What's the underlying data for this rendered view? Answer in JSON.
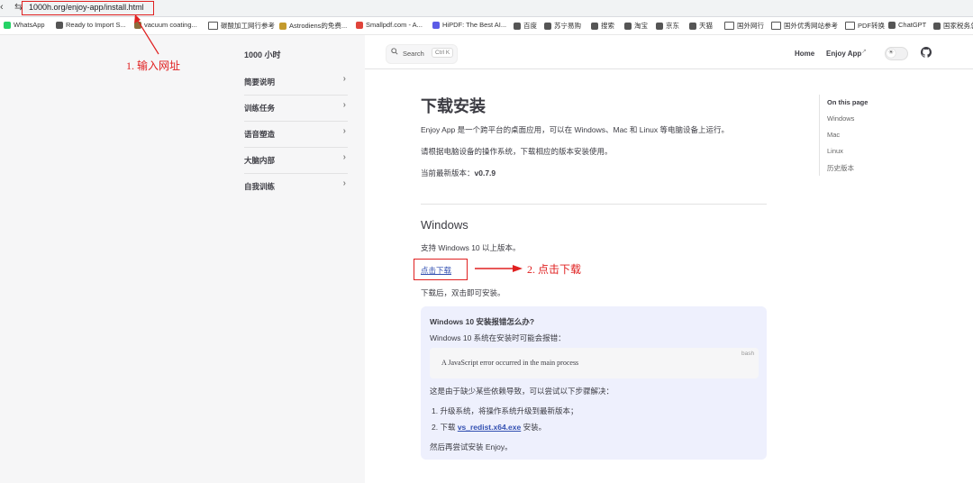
{
  "browser": {
    "url": "1000h.org/enjoy-app/install.html",
    "bookmarks": [
      {
        "label": "WhatsApp",
        "color": "#25d366"
      },
      {
        "label": "Ready to Import S...",
        "color": "#555555"
      },
      {
        "label": "vacuum coating...",
        "color": "#8a6d3b"
      },
      {
        "label": "碳酸加工网行参考",
        "color": "folder"
      },
      {
        "label": "Astrodiens的免费...",
        "color": "#c49a2c"
      },
      {
        "label": "Smallpdf.com - A...",
        "color": "#e0443a"
      },
      {
        "label": "HiPDF: The Best AI...",
        "color": "#5b5be6"
      },
      {
        "label": "百度",
        "color": "#555555"
      },
      {
        "label": "苏宁易购",
        "color": "#555555"
      },
      {
        "label": "搜索",
        "color": "#555555"
      },
      {
        "label": "淘宝",
        "color": "#555555"
      },
      {
        "label": "京东",
        "color": "#555555"
      },
      {
        "label": "天猫",
        "color": "#555555"
      },
      {
        "label": "国外网行",
        "color": "folder"
      },
      {
        "label": "国外优秀网站参考",
        "color": "folder"
      },
      {
        "label": "PDF转换",
        "color": "folder"
      },
      {
        "label": "ChatGPT",
        "color": "#555555"
      },
      {
        "label": "国家税务总",
        "color": "#555555"
      }
    ]
  },
  "sidebar": {
    "title": "1000 小时",
    "items": [
      "简要说明",
      "训练任务",
      "语音塑造",
      "大脑内部",
      "自我训练"
    ]
  },
  "topnav": {
    "search_label": "Search",
    "search_key": "Ctrl K",
    "home": "Home",
    "enjoy": "Enjoy App"
  },
  "content": {
    "title": "下载安装",
    "intro": "Enjoy App 是一个跨平台的桌面应用，可以在 Windows、Mac 和 Linux 等电脑设备上运行。",
    "choose": "请根据电脑设备的操作系统，下载相应的版本安装使用。",
    "version_label": "当前最新版本：",
    "version_value": "v0.7.9",
    "windows_heading": "Windows",
    "win_support": "支持 Windows 10 以上版本。",
    "download_link": "点击下载",
    "after_download": "下载后，双击即可安装。",
    "tip_title": "Windows 10 安装报错怎么办?",
    "tip_desc": "Windows 10 系统在安装时可能会报错：",
    "code_lang": "bash",
    "code_text": "A JavaScript error occurred in the main process",
    "reason": "这是由于缺少某些依赖导致，可以尝试以下步骤解决：",
    "step1": "1. 升级系统，将操作系统升级到最新版本；",
    "step2_prefix": "2. 下载 ",
    "step2_link": "vs_redist.x64.exe",
    "step2_suffix": " 安装。",
    "finally": "然后再尝试安装 Enjoy。"
  },
  "toc": {
    "title": "On this page",
    "items": [
      "Windows",
      "Mac",
      "Linux",
      "历史版本"
    ]
  },
  "annotations": {
    "step1": "1. 输入网址",
    "step2": "2. 点击下载",
    "color": "#e02020"
  },
  "colors": {
    "link": "#3451b2",
    "tip_bg": "#eef0fd",
    "sidebar_bg": "#f6f6f7"
  }
}
